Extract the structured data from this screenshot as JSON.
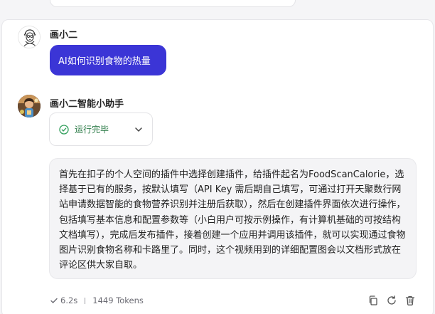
{
  "user": {
    "name": "画小二",
    "question": "AI如何识别食物的热量"
  },
  "bot": {
    "name": "画小二智能小助手",
    "status": "运行完毕",
    "answer": "首先在扣子的个人空间的插件中选择创建插件，给插件起名为FoodScanCalorie，选择基于已有的服务，按默认填写（API Key 需后期自己填写，可通过打开天聚数行网站申请数据智能的食物营养识别并注册后获取），然后在创建插件界面依次进行操作，包括填写基本信息和配置参数等（小白用户可按示例操作，有计算机基础的可按结构文档填写），完成后发布插件，接着创建一个应用并调用该插件，就可以实现通过食物图片识别食物名称和卡路里了。同时，这个视频用到的详细配置图会以文档形式放在评论区供大家自取。"
  },
  "meta": {
    "time": "6.2s",
    "tokens": "1449 Tokens"
  },
  "icons": {
    "status": "check-circle-icon",
    "expand": "chevron-down-icon",
    "meta": "checkmark-icon",
    "actions": [
      "copy-icon",
      "refresh-icon",
      "trash-icon"
    ]
  },
  "colors": {
    "accent": "#3b35d6",
    "success": "#2f7d4a"
  }
}
